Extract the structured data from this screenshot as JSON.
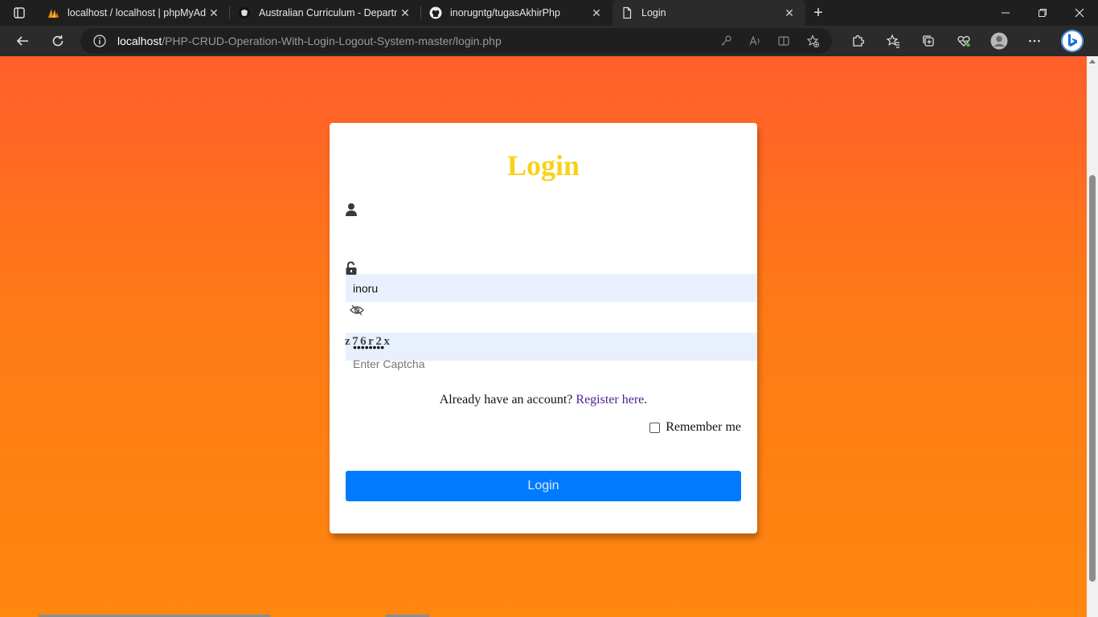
{
  "browser": {
    "tabs": [
      {
        "title": "localhost / localhost | phpMyAdmin",
        "favicon": "phpmyadmin-icon",
        "active": false
      },
      {
        "title": "Australian Curriculum - Department",
        "favicon": "coat-of-arms-icon",
        "active": false
      },
      {
        "title": "inorugntg/tugasAkhirPhp",
        "favicon": "github-icon",
        "active": false
      },
      {
        "title": "Login",
        "favicon": "page-icon",
        "active": true
      }
    ],
    "address": {
      "host": "localhost",
      "path": "/PHP-CRUD-Operation-With-Login-Logout-System-master/login.php"
    }
  },
  "login": {
    "title": "Login",
    "username_value": "inoru",
    "password_value": "••••••••",
    "captcha_code": "z76r2x",
    "captcha_placeholder": "Enter Captcha",
    "register_prefix": "Already have an account? ",
    "register_link": "Register here",
    "register_suffix": ".",
    "remember_label": "Remember me",
    "submit_label": "Login"
  },
  "colors": {
    "title_yellow": "#f7d21b",
    "button_blue": "#007bff",
    "bg_top": "#ff5f2b",
    "bg_bottom": "#ff860f",
    "input_bg": "#e8f0fe"
  }
}
